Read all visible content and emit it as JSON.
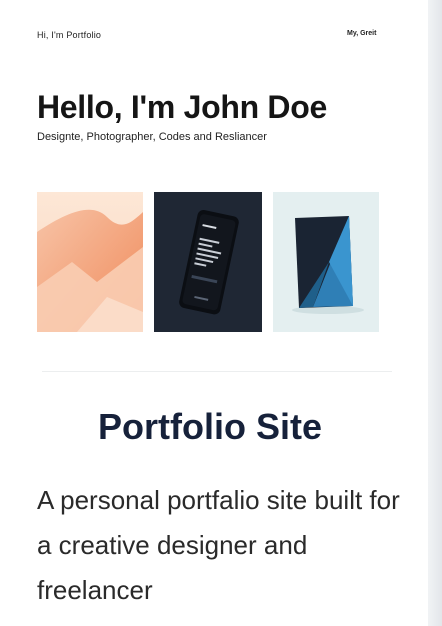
{
  "nav": {
    "brand": "Hi, I'm Portfolio",
    "link": "My, Greit"
  },
  "hero": {
    "greeting": "Hello, I'm",
    "name": "John Doe",
    "subtitle": "Designte, Photographer, Codes and Resliancer"
  },
  "gallery": {
    "items": [
      {
        "icon": "abstract-gradient-artwork",
        "accent": "#f4a27a"
      },
      {
        "icon": "phone-mockup-photo",
        "accent": "#1f2734"
      },
      {
        "icon": "blue-book-object-photo",
        "accent": "#2f7fb6"
      }
    ]
  },
  "project": {
    "title": "Portfolio Site",
    "description": "A personal portfalio site built for a creative designer and freelancer"
  }
}
